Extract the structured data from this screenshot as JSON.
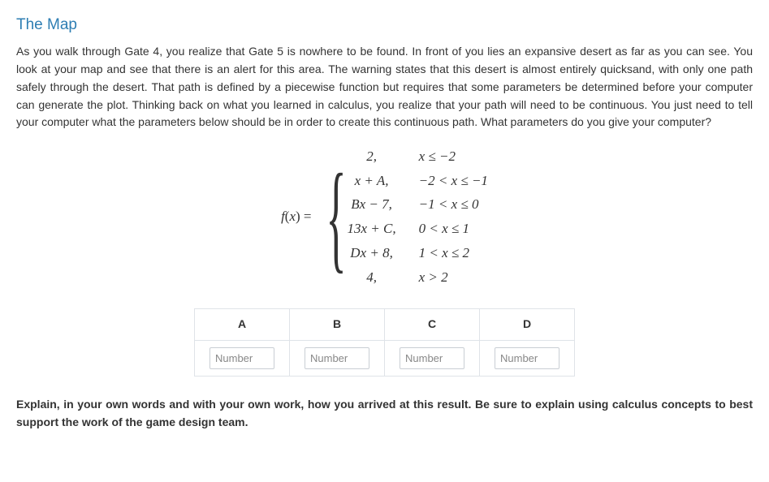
{
  "title": "The Map",
  "intro": "As you walk through Gate 4, you realize that Gate 5 is nowhere to be found. In front of you lies an expansive desert as far as you can see. You look at your map and see that there is an alert for this area. The warning states that this desert is almost entirely quicksand, with only one path safely through the desert. That path is defined by a piecewise function but requires that some parameters be determined before your computer can generate the plot. Thinking back on what you learned in calculus, you realize that your path will need to be continuous. You just need to tell your computer what the parameters below should be in order to create this continuous path. What parameters do you give your computer?",
  "formula": {
    "lhs": "f(x) = ",
    "pieces": [
      {
        "expr": "2,",
        "cond": "x ≤ −2"
      },
      {
        "expr": "x + A,",
        "cond": "−2 < x ≤ −1"
      },
      {
        "expr": "Bx − 7,",
        "cond": "−1 < x ≤ 0"
      },
      {
        "expr": "13x + C,",
        "cond": "0 < x ≤ 1"
      },
      {
        "expr": "Dx + 8,",
        "cond": "1 < x ≤ 2"
      },
      {
        "expr": "4,",
        "cond": "x > 2"
      }
    ]
  },
  "answers": {
    "headers": [
      "A",
      "B",
      "C",
      "D"
    ],
    "placeholder": "Number"
  },
  "explain": "Explain, in your own words and with your own work, how you arrived at this result. Be sure to explain using calculus concepts to best support the work of the game design team."
}
